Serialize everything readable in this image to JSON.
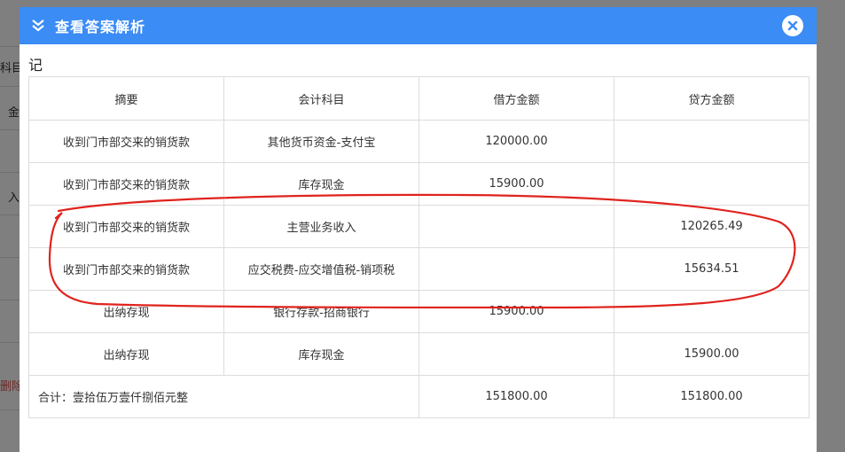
{
  "background": {
    "labels": [
      "科目",
      "金",
      "入",
      "删除"
    ]
  },
  "modal": {
    "title": "查看答案解析",
    "voucher_type": "记",
    "columns": [
      "摘要",
      "会计科目",
      "借方金额",
      "贷方金额"
    ],
    "rows": [
      {
        "summary": "收到门市部交来的销货款",
        "account": "其他货币资金-支付宝",
        "debit": "120000.00",
        "credit": ""
      },
      {
        "summary": "收到门市部交来的销货款",
        "account": "库存现金",
        "debit": "15900.00",
        "credit": ""
      },
      {
        "summary": "收到门市部交来的销货款",
        "account": "主营业务收入",
        "debit": "",
        "credit": "120265.49"
      },
      {
        "summary": "收到门市部交来的销货款",
        "account": "应交税费-应交增值税-销项税",
        "debit": "",
        "credit": "15634.51"
      },
      {
        "summary": "出纳存现",
        "account": "银行存款-招商银行",
        "debit": "15900.00",
        "credit": ""
      },
      {
        "summary": "出纳存现",
        "account": "库存现金",
        "debit": "",
        "credit": "15900.00"
      }
    ],
    "total": {
      "label": "合计：壹拾伍万壹仟捌佰元整",
      "debit": "151800.00",
      "credit": "151800.00"
    }
  },
  "colors": {
    "header": "#3b8cf5",
    "annotation": "#e0231e"
  }
}
